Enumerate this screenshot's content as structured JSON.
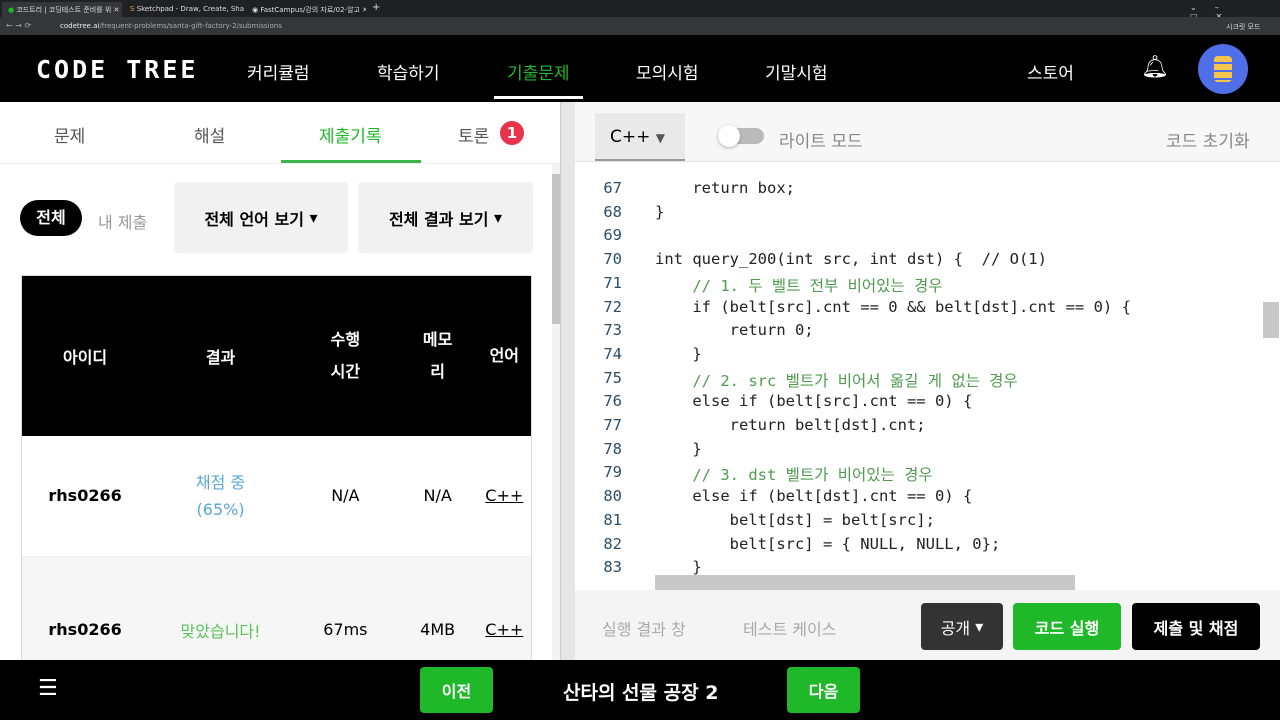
{
  "browser": {
    "tabs": [
      {
        "label": "코드트리 | 코딩테스트 준비를 위"
      },
      {
        "label": "Sketchpad - Draw, Create, Shar"
      },
      {
        "label": "FastCampus/강의 자료/02-알고"
      }
    ],
    "url_domain": "codetree.ai",
    "url_path": "/frequent-problems/santa-gift-factory-2/submissions",
    "profile": "시크릿 모드"
  },
  "nav": {
    "logo": "CODE TREE",
    "items": [
      {
        "label": "커리큘럼"
      },
      {
        "label": "학습하기"
      },
      {
        "label": "기출문제"
      },
      {
        "label": "모의시험"
      },
      {
        "label": "기말시험"
      }
    ],
    "store": "스토어",
    "accent": "#1fb829"
  },
  "left": {
    "tabs": [
      {
        "label": "문제"
      },
      {
        "label": "해설"
      },
      {
        "label": "제출기록"
      },
      {
        "label": "토론"
      }
    ],
    "discussion_badge": "1",
    "filters": {
      "all": "전체",
      "mine": "내 제출",
      "language": "전체 언어 보기",
      "result": "전체 결과 보기"
    },
    "table": {
      "headers": [
        "아이디",
        "결과",
        "수행 시간",
        "메모리",
        "언어"
      ],
      "rows": [
        {
          "id": "rhs0266",
          "result": "채점 중 (65%)",
          "time": "N/A",
          "memory": "N/A",
          "lang": "C++"
        },
        {
          "id": "rhs0266",
          "result": "맞았습니다!",
          "time": "67ms",
          "memory": "4MB",
          "lang": "C++"
        }
      ]
    }
  },
  "editor": {
    "language": "C++",
    "light_mode": "라이트 모드",
    "reset": "코드 초기화",
    "code": [
      {
        "n": "67",
        "text": "    return box;"
      },
      {
        "n": "68",
        "text": "}"
      },
      {
        "n": "69",
        "text": ""
      },
      {
        "n": "70",
        "text": "int query_200(int src, int dst) {  // O(1)"
      },
      {
        "n": "71",
        "text": "    // 1. 두 벨트 전부 비어있는 경우"
      },
      {
        "n": "72",
        "text": "    if (belt[src].cnt == 0 && belt[dst].cnt == 0) {"
      },
      {
        "n": "73",
        "text": "        return 0;"
      },
      {
        "n": "74",
        "text": "    }"
      },
      {
        "n": "75",
        "text": "    // 2. src 벨트가 비어서 옮길 게 없는 경우"
      },
      {
        "n": "76",
        "text": "    else if (belt[src].cnt == 0) {"
      },
      {
        "n": "77",
        "text": "        return belt[dst].cnt;"
      },
      {
        "n": "78",
        "text": "    }"
      },
      {
        "n": "79",
        "text": "    // 3. dst 벨트가 비어있는 경우"
      },
      {
        "n": "80",
        "text": "    else if (belt[dst].cnt == 0) {"
      },
      {
        "n": "81",
        "text": "        belt[dst] = belt[src];"
      },
      {
        "n": "82",
        "text": "        belt[src] = { NULL, NULL, 0};"
      },
      {
        "n": "83",
        "text": "    }"
      }
    ],
    "bottom": {
      "result_tab": "실행 결과 창",
      "testcase_tab": "테스트 케이스",
      "visibility": "공개",
      "run": "코드 실행",
      "submit": "제출 및 채점"
    }
  },
  "footer": {
    "prev": "이전",
    "title": "산타의 선물 공장 2",
    "next": "다음"
  }
}
